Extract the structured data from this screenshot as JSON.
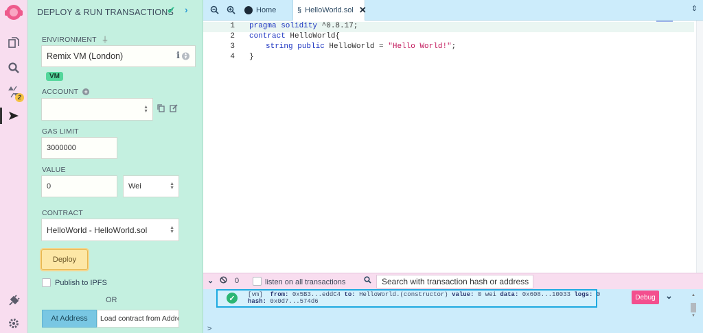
{
  "rail": {
    "items": [
      "remix-logo",
      "file-explorer-icon",
      "search-icon",
      "solidity-compiler-icon",
      "deploy-run-icon",
      "plugin-manager-icon",
      "settings-icon"
    ],
    "compiler_badge": "2"
  },
  "panel": {
    "title": "DEPLOY & RUN TRANSACTIONS",
    "environment_label": "ENVIRONMENT",
    "environment_value": "Remix VM (London)",
    "vm_chip": "VM",
    "account_label": "ACCOUNT",
    "account_value": "",
    "gas_limit_label": "GAS LIMIT",
    "gas_limit_value": "3000000",
    "value_label": "VALUE",
    "value_amount": "0",
    "value_unit": "Wei",
    "contract_label": "CONTRACT",
    "contract_value": "HelloWorld - HelloWorld.sol",
    "deploy_label": "Deploy",
    "publish_label": "Publish to IPFS",
    "or_label": "OR",
    "at_address_label": "At Address",
    "load_contract_placeholder": "Load contract from Addres"
  },
  "tabs": {
    "home_label": "Home",
    "file_label": "HelloWorld.sol"
  },
  "editor": {
    "line_numbers": [
      "1",
      "2",
      "3",
      "4"
    ],
    "lines": {
      "l1_kw": "pragma solidity",
      "l1_rest": " ^0.8.17;",
      "l2_kw": "contract",
      "l2_rest": " HelloWorld{",
      "l3_kw1": "string",
      "l3_kw2": "public",
      "l3_rest": " HelloWorld = ",
      "l3_str": "\"Hello World!\"",
      "l3_end": ";",
      "l4": "}"
    }
  },
  "terminal": {
    "count": "0",
    "listen_label": "listen on all transactions",
    "search_placeholder": "Search with transaction hash or address",
    "tx": {
      "prefix": "[vm]",
      "from_label": "from:",
      "from_value": "0x5B3...eddC4",
      "to_label": "to:",
      "to_value": "HelloWorld.(constructor)",
      "value_label": "value:",
      "value_value": "0 wei",
      "data_label": "data:",
      "data_value": "0x608...10033",
      "logs_label": "logs:",
      "logs_value": "0",
      "hash_label": "hash:",
      "hash_value": "0x0d7...574d6"
    },
    "debug_label": "Debug",
    "prompt": ">"
  }
}
